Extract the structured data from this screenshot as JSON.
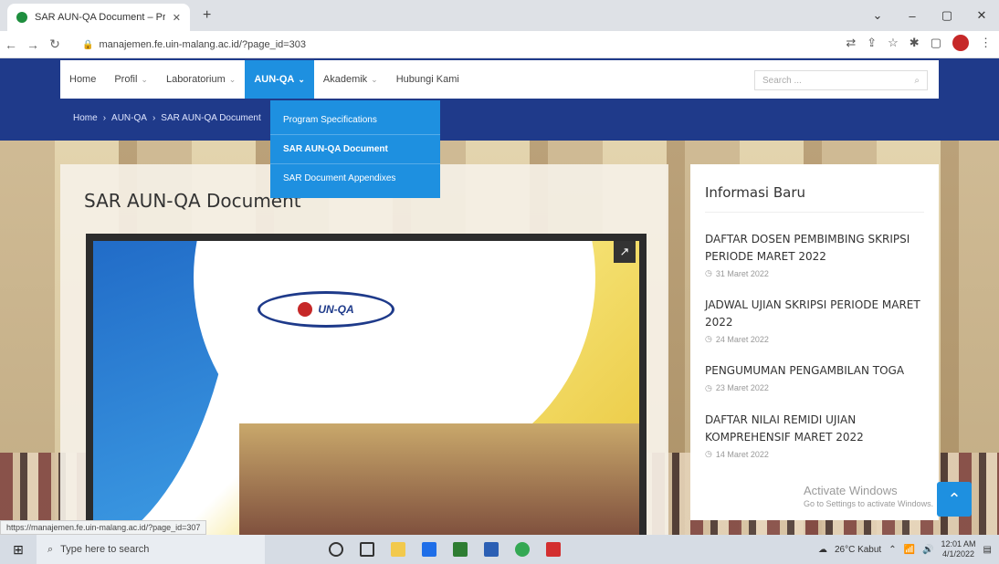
{
  "browser": {
    "tab_title": "SAR AUN-QA Document – Prog",
    "tab_close": "✕",
    "new_tab": "+",
    "url": "manajemen.fe.uin-malang.ac.id/?page_id=303",
    "window_controls": [
      "⌄",
      "–",
      "▢",
      "✕"
    ]
  },
  "nav": {
    "items": [
      {
        "label": "Home",
        "chev": ""
      },
      {
        "label": "Profil",
        "chev": "⌄"
      },
      {
        "label": "Laboratorium",
        "chev": "⌄"
      },
      {
        "label": "AUN-QA",
        "chev": "⌄"
      },
      {
        "label": "Akademik",
        "chev": "⌄"
      },
      {
        "label": "Hubungi Kami",
        "chev": ""
      }
    ],
    "search_placeholder": "Search ..."
  },
  "breadcrumb": [
    "Home",
    "›",
    "AUN-QA",
    "›",
    "SAR AUN-QA Document"
  ],
  "dropdown": [
    "Program Specifications",
    "SAR AUN-QA Document",
    "SAR Document Appendixes"
  ],
  "content": {
    "title": "SAR AUN-QA Document",
    "logo_text": "UN-QA",
    "popout_icon": "↗"
  },
  "status_url": "https://manajemen.fe.uin-malang.ac.id/?page_id=307",
  "sidebar": {
    "title": "Informasi Baru",
    "items": [
      {
        "title": "DAFTAR DOSEN PEMBIMBING SKRIPSI PERIODE MARET 2022",
        "date": "31 Maret 2022"
      },
      {
        "title": "JADWAL UJIAN SKRIPSI PERIODE MARET 2022",
        "date": "24 Maret 2022"
      },
      {
        "title": "PENGUMUMAN PENGAMBILAN TOGA",
        "date": "23 Maret 2022"
      },
      {
        "title": "DAFTAR NILAI REMIDI UJIAN KOMPREHENSIF MARET 2022",
        "date": "14 Maret 2022"
      }
    ]
  },
  "watermark": {
    "title": "Activate Windows",
    "sub": "Go to Settings to activate Windows."
  },
  "taskbar": {
    "search": "Type here to search",
    "weather": "26°C Kabut",
    "time": "12:01 AM",
    "date": "4/1/2022"
  },
  "colors": {
    "nav_blue": "#1f3a8a",
    "accent": "#1e90e0"
  }
}
